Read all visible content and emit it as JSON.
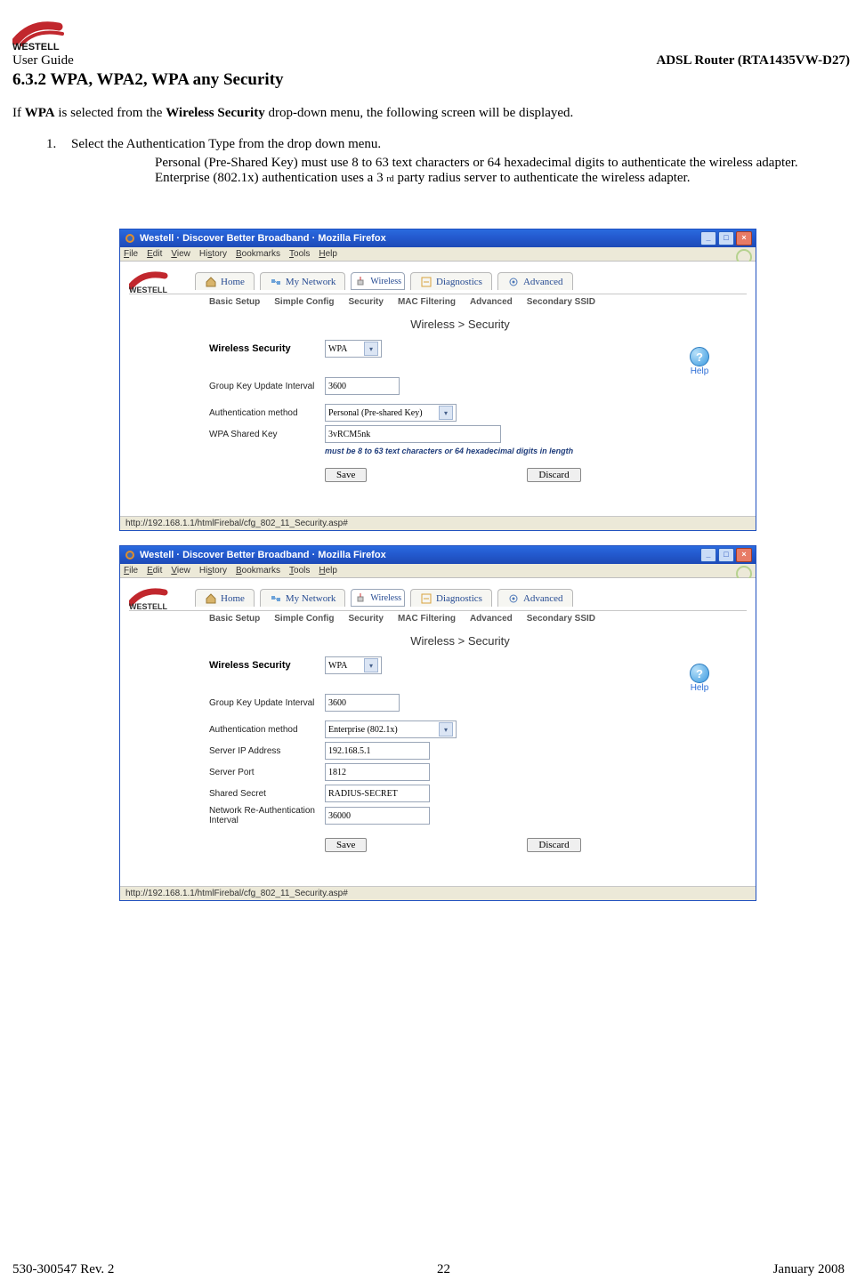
{
  "header": {
    "brand": "WESTELL",
    "guide": "User Guide",
    "model": "ADSL Router (RTA1435VW-D27)",
    "section_title": "6.3.2 WPA, WPA2, WPA any Security"
  },
  "intro": {
    "prefix": "If ",
    "wpa": "WPA",
    "mid": " is selected from the ",
    "ws": "Wireless Security",
    "suffix": " drop-down menu, the following screen will be displayed."
  },
  "step": {
    "num": "1.",
    "text": "Select the Authentication Type from the drop down menu.",
    "sub_a": "Personal (Pre-Shared Key) must use 8 to 63 text characters or 64 hexadecimal digits to authenticate the wireless adapter. Enterprise (802.1x) authentication uses a 3 ",
    "sub_rd": "rd",
    "sub_b": " party radius server to authenticate the wireless adapter."
  },
  "window": {
    "title": "Westell · Discover Better Broadband · Mozilla Firefox",
    "menu": [
      "File",
      "Edit",
      "View",
      "History",
      "Bookmarks",
      "Tools",
      "Help"
    ],
    "brand": "WESTELL",
    "tabs": [
      "Home",
      "My Network",
      "Wireless",
      "Diagnostics",
      "Advanced"
    ],
    "subtabs": [
      "Basic Setup",
      "Simple Config",
      "Security",
      "MAC Filtering",
      "Advanced",
      "Secondary SSID"
    ],
    "panel_title": "Wireless > Security",
    "help": "Help",
    "status_url": "http://192.168.1.1/htmlFirebal/cfg_802_11_Security.asp#",
    "save": "Save",
    "discard": "Discard"
  },
  "shot1": {
    "rows": {
      "wireless_security": {
        "label": "Wireless Security",
        "value": "WPA"
      },
      "group_key": {
        "label": "Group Key Update Interval",
        "value": "3600"
      },
      "auth": {
        "label": "Authentication method",
        "value": "Personal (Pre-shared Key)"
      },
      "wpakey": {
        "label": "WPA Shared Key",
        "value": "3vRCM5nk"
      }
    },
    "hint": "must be 8 to 63 text characters or 64 hexadecimal digits in length"
  },
  "shot2": {
    "rows": {
      "wireless_security": {
        "label": "Wireless Security",
        "value": "WPA"
      },
      "group_key": {
        "label": "Group Key Update Interval",
        "value": "3600"
      },
      "auth": {
        "label": "Authentication method",
        "value": "Enterprise (802.1x)"
      },
      "serverip": {
        "label": "Server IP Address",
        "value": "192.168.5.1"
      },
      "serverport": {
        "label": "Server Port",
        "value": "1812"
      },
      "secret": {
        "label": "Shared Secret",
        "value": "RADIUS-SECRET"
      },
      "reauth": {
        "label": "Network Re-Authentication Interval",
        "value": "36000"
      }
    }
  },
  "footer": {
    "left": "530-300547 Rev. 2",
    "center": "22",
    "right": "January 2008"
  }
}
